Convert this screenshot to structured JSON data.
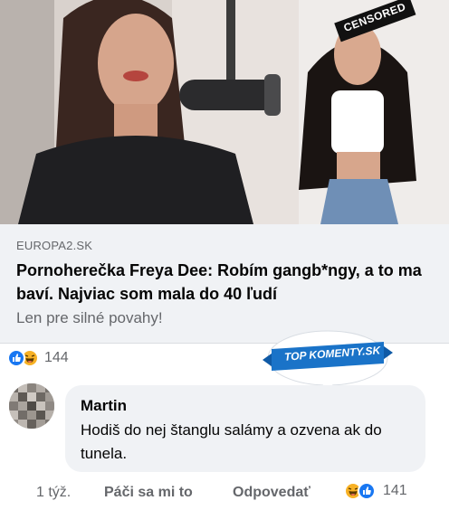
{
  "preview": {
    "censored_label": "CENSORED",
    "domain": "EUROPA2.SK",
    "headline": "Pornoherečka Freya Dee: Robím gangb*ngy, a to ma baví. Najviac som mala do 40 ľudí",
    "subtitle": "Len pre silné povahy!"
  },
  "post_reactions": {
    "icons": [
      "like-icon",
      "haha-icon"
    ],
    "count": "144"
  },
  "badge": {
    "label": "TOP KOMENTY.SK",
    "color": "#1a73c8"
  },
  "comment": {
    "author": "Martin",
    "text": "Hodiš do nej štanglu salámy a ozvena ak do tunela.",
    "time": "1 týž.",
    "like_label": "Páči sa mi to",
    "reply_label": "Odpovedať",
    "reaction_icons": [
      "haha-icon",
      "like-icon"
    ],
    "reaction_count": "141"
  },
  "colors": {
    "like_blue": "#1877f2",
    "haha_yellow": "#f7b125",
    "secondary_text": "#65676b",
    "bubble_bg": "#f0f2f5"
  }
}
